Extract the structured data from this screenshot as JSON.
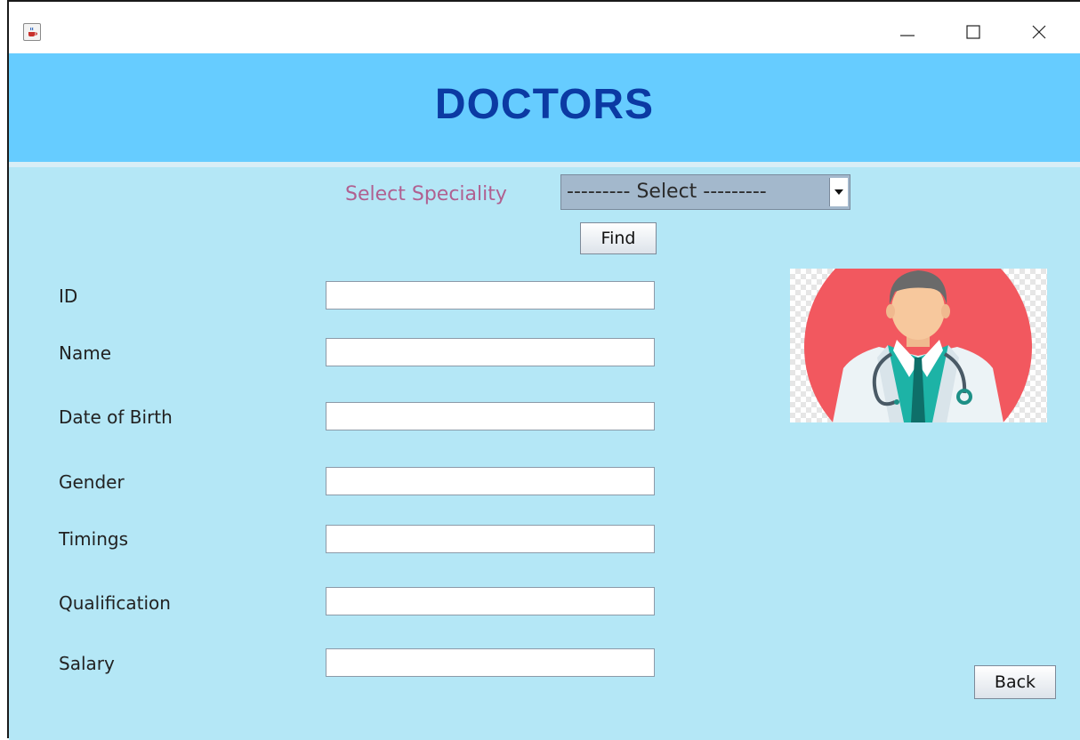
{
  "window": {
    "app_icon": "java-cup-icon",
    "controls": {
      "minimize": "minimize-icon",
      "maximize": "maximize-icon",
      "close": "close-icon"
    }
  },
  "header": {
    "title": "DOCTORS",
    "background": "#66ccff",
    "title_color": "#0b3aa3"
  },
  "speciality": {
    "label": "Select Speciality",
    "selected": "--------- Select ---------",
    "arrow_icon": "caret-down-icon"
  },
  "find_button": "Find",
  "fields": [
    {
      "label": "ID",
      "value": ""
    },
    {
      "label": "Name",
      "value": ""
    },
    {
      "label": "Date of Birth",
      "value": ""
    },
    {
      "label": "Gender",
      "value": ""
    },
    {
      "label": "Timings",
      "value": ""
    },
    {
      "label": "Qualification",
      "value": ""
    },
    {
      "label": "Salary",
      "value": ""
    }
  ],
  "doctor_image": "doctor-illustration",
  "back_button": "Back",
  "colors": {
    "content_bg": "#b4e7f6",
    "label_pink": "#b06090",
    "circle_red": "#f2585f"
  }
}
